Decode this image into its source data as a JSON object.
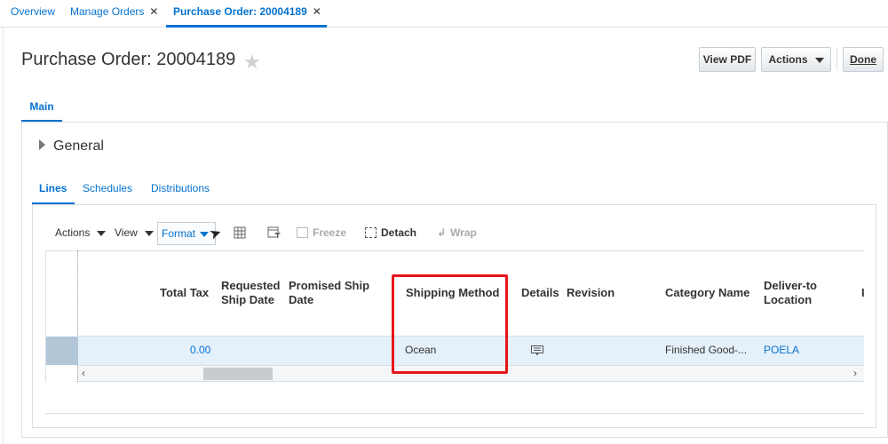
{
  "top_tabs": [
    {
      "label": "Overview",
      "closable": false,
      "active": false
    },
    {
      "label": "Manage Orders",
      "closable": true,
      "active": false
    },
    {
      "label": "Purchase Order: 20004189",
      "closable": true,
      "active": true
    }
  ],
  "close_glyph": "✕",
  "header": {
    "title": "Purchase Order: 20004189",
    "favorite_icon": "star-icon",
    "buttons": {
      "view_pdf": "View PDF",
      "actions": "Actions",
      "done": "Done"
    }
  },
  "main_tab": "Main",
  "general_section": {
    "label": "General",
    "expanded": false
  },
  "sub_tabs": [
    "Lines",
    "Schedules",
    "Distributions"
  ],
  "toolbar": {
    "actions": "Actions",
    "view": "View",
    "format": "Format",
    "freeze": "Freeze",
    "detach": "Detach",
    "wrap": "Wrap"
  },
  "table": {
    "columns": {
      "total_tax": "Total Tax",
      "requested_ship_date_1": "Requested",
      "requested_ship_date_2": "Ship Date",
      "promised_ship_date_1": "Promised Ship",
      "promised_ship_date_2": "Date",
      "shipping_method": "Shipping Method",
      "details": "Details",
      "revision": "Revision",
      "category_name": "Category Name",
      "deliver_to_1": "Deliver-to",
      "deliver_to_2": "Location"
    },
    "rows": [
      {
        "total_tax": "0.00",
        "requested_ship_date": "",
        "promised_ship_date": "",
        "shipping_method": "Ocean",
        "details_icon": "details-icon",
        "revision": "",
        "category_name": "Finished Good-...",
        "deliver_to_location": "POELA"
      }
    ]
  },
  "scroll_left": "‹",
  "scroll_right": "›",
  "colors": {
    "accent": "#0572ce",
    "highlight": "#e8151b",
    "selected_row": "#e4f0fa"
  }
}
